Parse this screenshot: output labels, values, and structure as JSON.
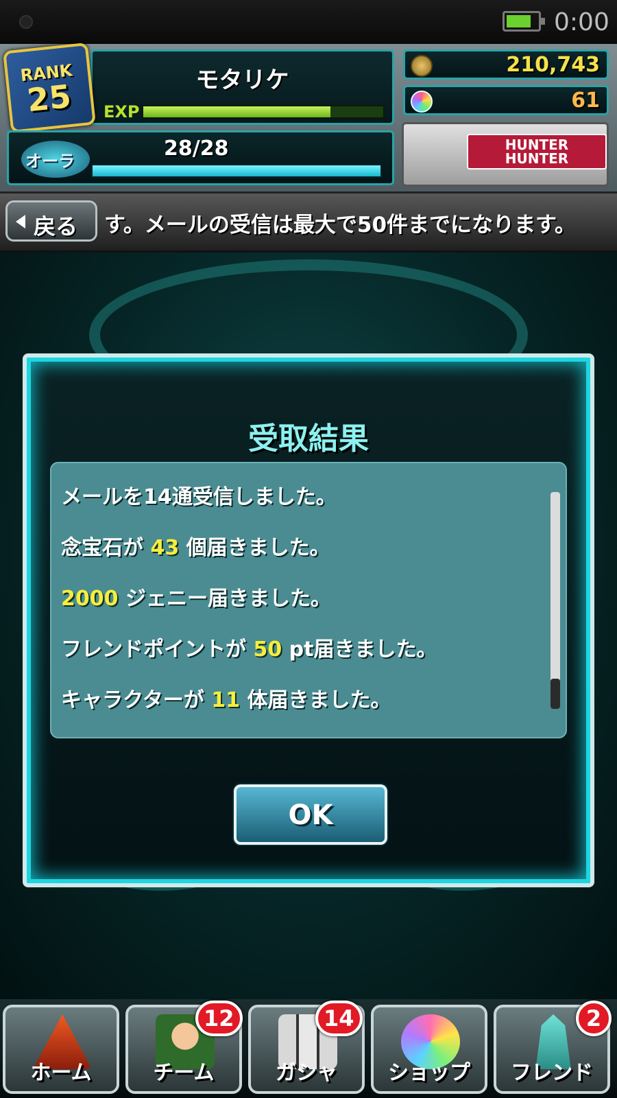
{
  "status_bar": {
    "time": "0:00",
    "battery_level": 0.8
  },
  "header": {
    "rank_label": "RANK",
    "rank_value": "25",
    "player_name": "モタリケ",
    "exp_label": "EXP",
    "exp_fill": 0.78,
    "aura_label": "オーラ",
    "aura_count": "28/28",
    "aura_fill": 1.0,
    "jenny": "210,743",
    "gems": "61",
    "logo_text": "HUNTER HUNTER"
  },
  "nav": {
    "back_label": "戻る",
    "ticker_text": "す。メールの受信は最大で50件までになります。"
  },
  "dialog": {
    "title": "受取結果",
    "lines": [
      {
        "before": "メールを14通受信しました。",
        "highlight": "",
        "after": ""
      },
      {
        "before": "念宝石が ",
        "highlight": "43",
        "after": " 個届きました。"
      },
      {
        "before": "",
        "highlight": "2000",
        "after": " ジェニー届きました。"
      },
      {
        "before": "フレンドポイントが ",
        "highlight": "50",
        "after": " pt届きました。"
      },
      {
        "before": "キャラクターが ",
        "highlight": "11",
        "after": " 体届きました。"
      }
    ],
    "ok_label": "OK"
  },
  "bottom_nav": [
    {
      "label": "ホーム",
      "badge": ""
    },
    {
      "label": "チーム",
      "badge": "12"
    },
    {
      "label": "ガシャ",
      "badge": "14"
    },
    {
      "label": "ショップ",
      "badge": ""
    },
    {
      "label": "フレンド",
      "badge": "2"
    }
  ],
  "colors": {
    "accent_cyan": "#1ed5e0",
    "highlight_yellow": "#f7ee3a",
    "badge_red": "#e11a25"
  }
}
